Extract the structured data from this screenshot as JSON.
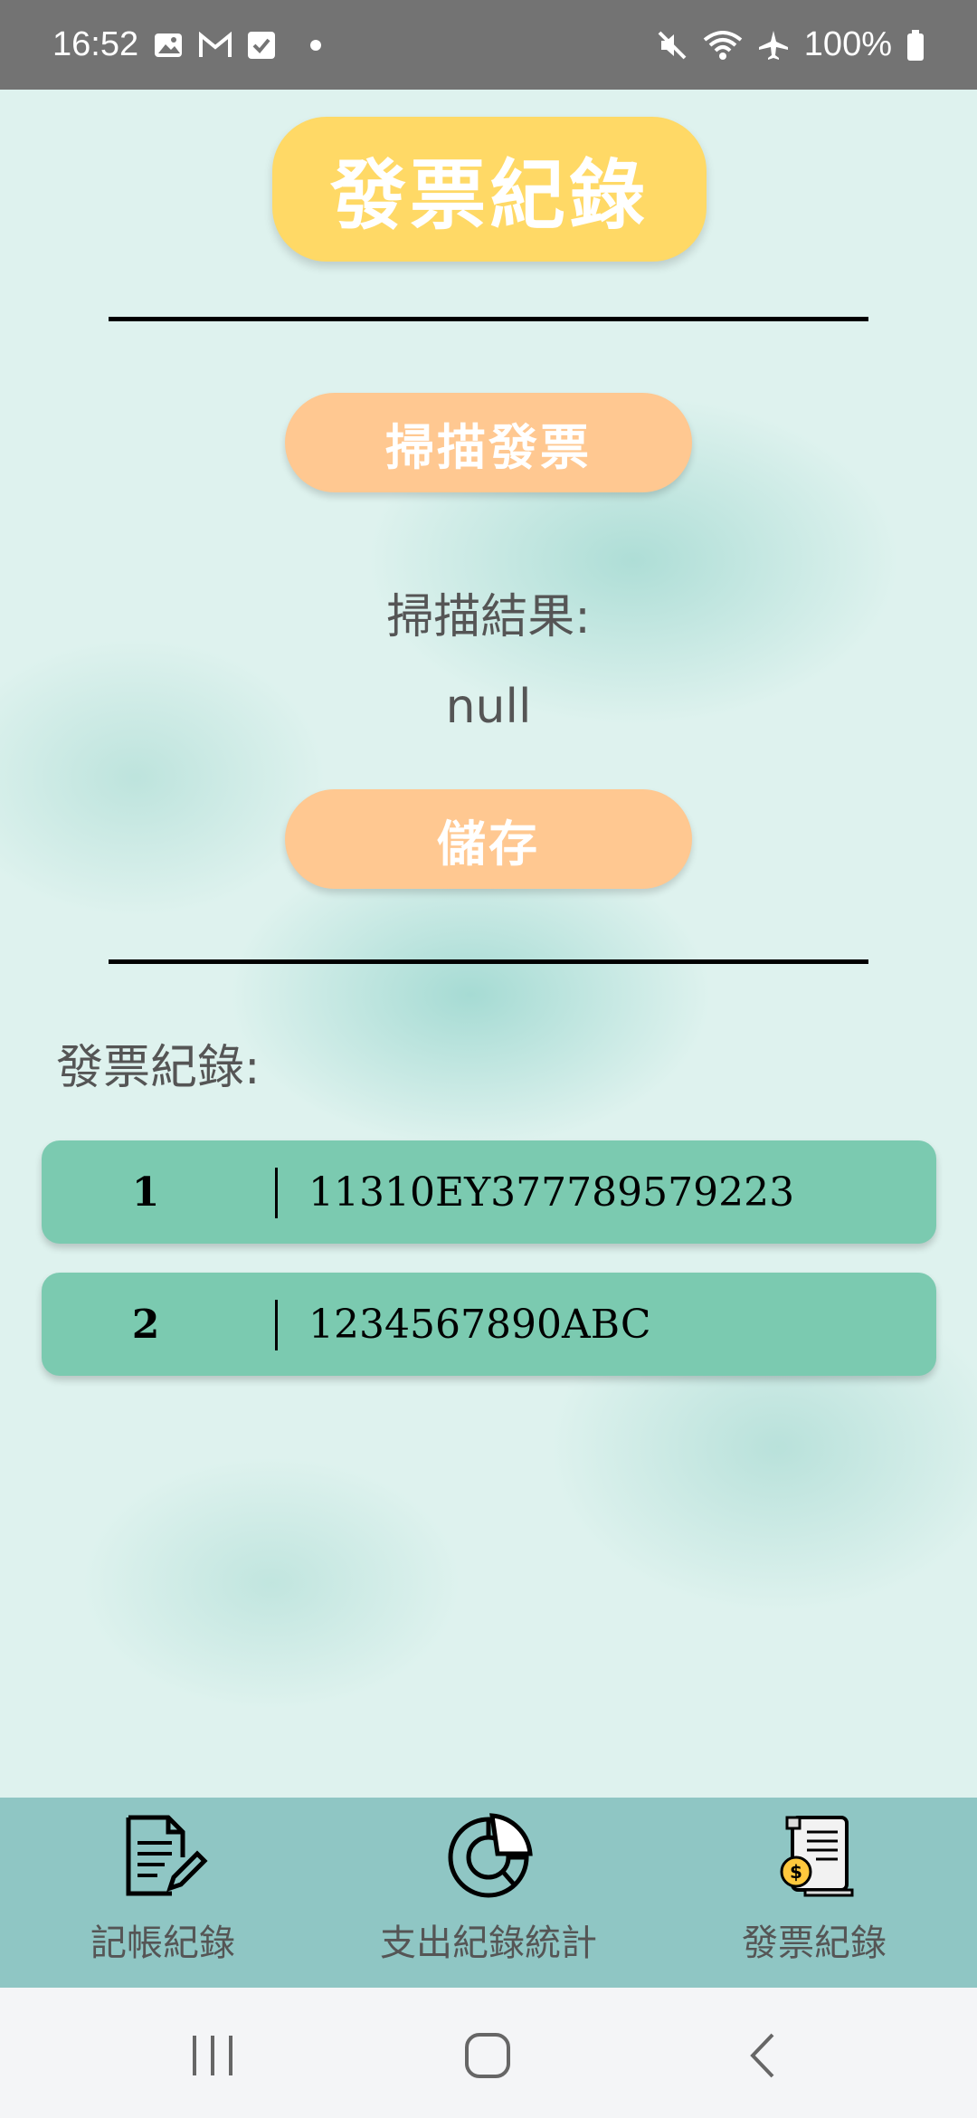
{
  "status_bar": {
    "time": "16:52",
    "battery": "100%",
    "left_icons": [
      "gallery-icon",
      "gmail-icon",
      "check-icon",
      "dot-icon"
    ],
    "right_icons": [
      "mute-icon",
      "wifi-icon",
      "airplane-icon",
      "battery-icon"
    ]
  },
  "header": {
    "title": "發票紀錄"
  },
  "scan": {
    "scan_button": "掃描發票",
    "result_label": "掃描結果:",
    "result_value": "null",
    "save_button": "儲存"
  },
  "records": {
    "label": "發票紀錄:",
    "rows": [
      {
        "index": "1",
        "code": "11310EY377789579223"
      },
      {
        "index": "2",
        "code": "1234567890ABC"
      }
    ]
  },
  "bottom_nav": {
    "items": [
      {
        "label": "記帳紀錄",
        "icon": "document-edit-icon"
      },
      {
        "label": "支出紀錄統計",
        "icon": "pie-chart-icon"
      },
      {
        "label": "發票紀錄",
        "icon": "receipt-icon"
      }
    ]
  },
  "system_nav": {
    "icons": [
      "recents-icon",
      "home-icon",
      "back-icon"
    ]
  },
  "colors": {
    "title_pill": "#ffd966",
    "orange_button": "#ffc891",
    "record_row": "#7bcab0",
    "bottom_nav": "#8fc6c4",
    "status_bar": "#737373"
  }
}
